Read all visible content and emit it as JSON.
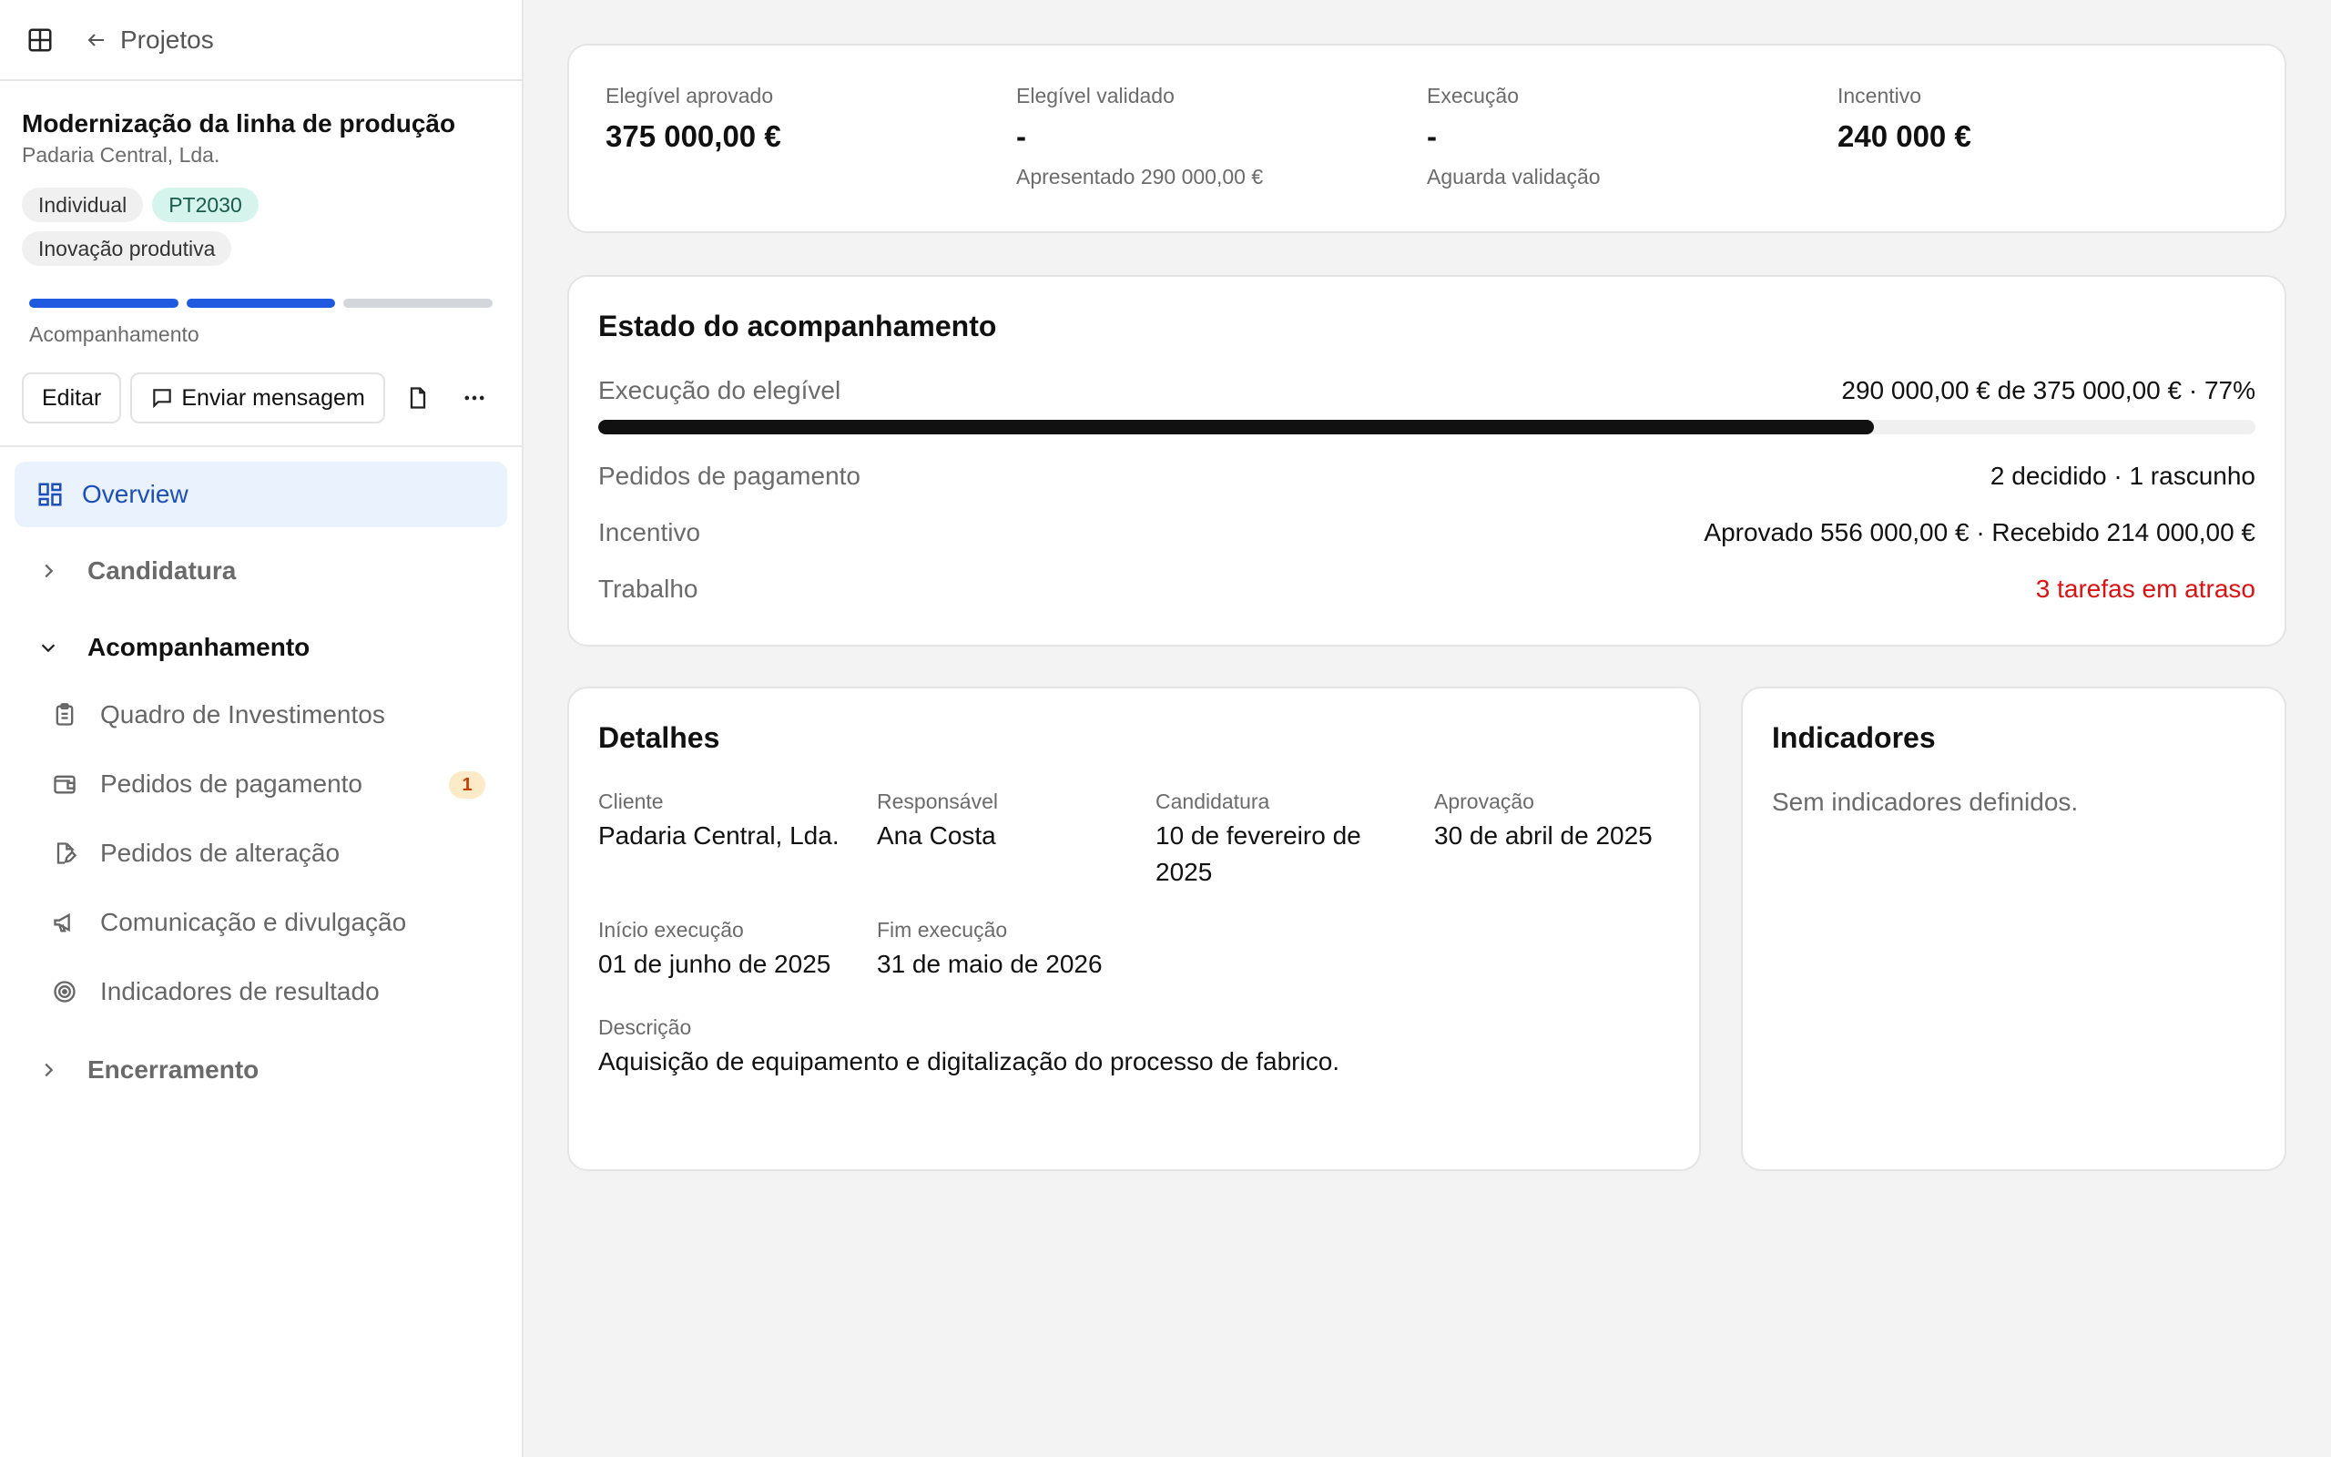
{
  "nav_top": {
    "back_label": "Projetos"
  },
  "project": {
    "title": "Modernização da linha de produção",
    "client": "Padaria Central, Lda.",
    "tags": [
      "Individual",
      "PT2030",
      "Inovação produtiva"
    ],
    "phase_label": "Acompanhamento",
    "phase_progress": {
      "completed_steps": 2,
      "total_steps": 3
    }
  },
  "actions": {
    "edit": "Editar",
    "message": "Enviar mensagem"
  },
  "sidebar": {
    "overview": "Overview",
    "groups": [
      {
        "label": "Candidatura",
        "expanded": false
      },
      {
        "label": "Acompanhamento",
        "expanded": true
      },
      {
        "label": "Encerramento",
        "expanded": false
      }
    ],
    "sub_items": [
      {
        "label": "Quadro de Investimentos",
        "icon": "clipboard-icon"
      },
      {
        "label": "Pedidos de pagamento",
        "icon": "wallet-icon",
        "badge": "1"
      },
      {
        "label": "Pedidos de alteração",
        "icon": "file-edit-icon"
      },
      {
        "label": "Comunicação e divulgação",
        "icon": "megaphone-icon"
      },
      {
        "label": "Indicadores de resultado",
        "icon": "target-icon"
      }
    ]
  },
  "stats": [
    {
      "label": "Elegível aprovado",
      "value": "375 000,00 €",
      "sub": ""
    },
    {
      "label": "Elegível validado",
      "value": "-",
      "sub": "Apresentado 290 000,00 €"
    },
    {
      "label": "Execução",
      "value": "-",
      "sub": "Aguarda validação"
    },
    {
      "label": "Incentivo",
      "value": "240 000 €",
      "sub": ""
    }
  ],
  "status": {
    "title": "Estado do acompanhamento",
    "execution_label": "Execução do elegível",
    "execution_value": "290 000,00 € de 375 000,00 € · 77%",
    "execution_fraction": 0.77,
    "rows": [
      {
        "label": "Pedidos de pagamento",
        "value": "2 decidido · 1 rascunho"
      },
      {
        "label": "Incentivo",
        "value": "Aprovado 556 000,00 € · Recebido 214 000,00 €"
      },
      {
        "label": "Trabalho",
        "value": "3 tarefas em atraso"
      }
    ],
    "warning_color": "#dc1212"
  },
  "details": {
    "title": "Detalhes",
    "fields": [
      {
        "label": "Cliente",
        "value": "Padaria Central, Lda."
      },
      {
        "label": "Responsável",
        "value": "Ana Costa"
      },
      {
        "label": "Candidatura",
        "value": "10 de fevereiro de 2025"
      },
      {
        "label": "Aprovação",
        "value": "30 de abril de 2025"
      },
      {
        "label": "Início execução",
        "value": "01 de junho de 2025"
      },
      {
        "label": "Fim execução",
        "value": "31 de maio de 2026"
      }
    ],
    "description_label": "Descrição",
    "description": "Aquisição de equipamento e digitalização do processo de fabrico."
  },
  "indicators": {
    "title": "Indicadores",
    "empty": "Sem indicadores definidos."
  },
  "colors": {
    "accent": "#1f5ae0",
    "active_bg": "#eaf2fe",
    "badge_bg": "#fdebc8"
  }
}
